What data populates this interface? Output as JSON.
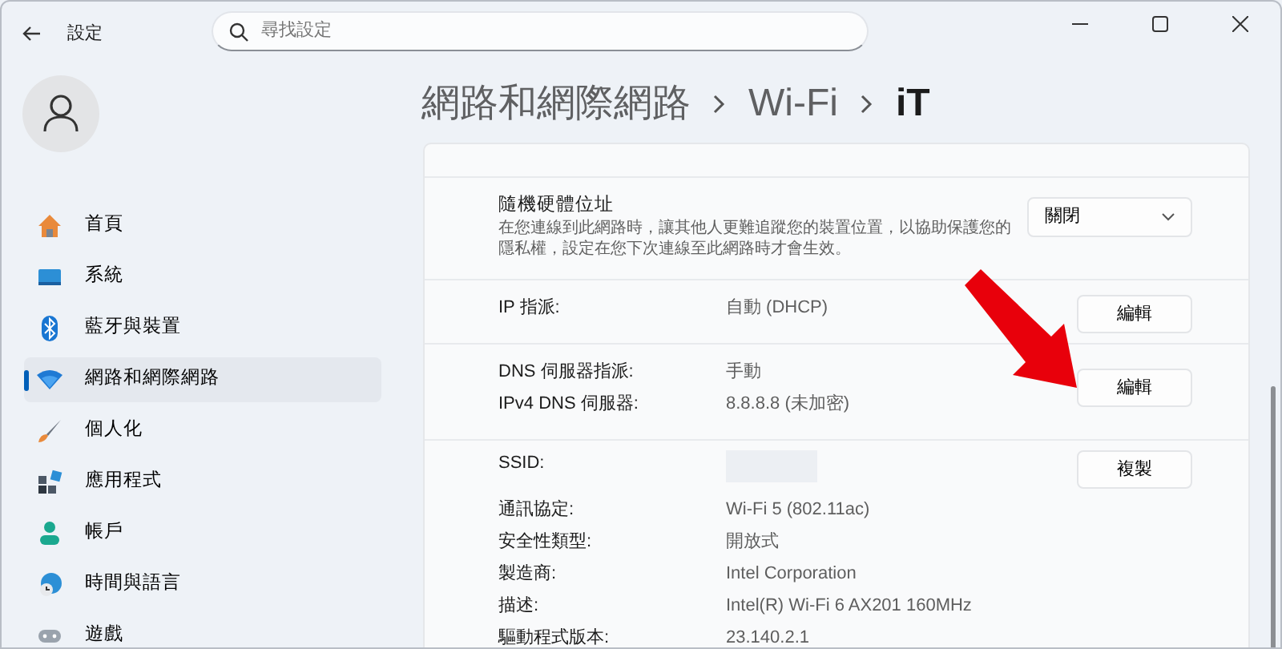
{
  "window": {
    "title": "設定"
  },
  "search": {
    "placeholder": "尋找設定"
  },
  "sidebar": {
    "items": [
      {
        "label": "首頁",
        "selected": false
      },
      {
        "label": "系統",
        "selected": false
      },
      {
        "label": "藍牙與裝置",
        "selected": false
      },
      {
        "label": "網路和網際網路",
        "selected": true
      },
      {
        "label": "個人化",
        "selected": false
      },
      {
        "label": "應用程式",
        "selected": false
      },
      {
        "label": "帳戶",
        "selected": false
      },
      {
        "label": "時間與語言",
        "selected": false
      },
      {
        "label": "遊戲",
        "selected": false
      }
    ]
  },
  "breadcrumb": [
    "網路和網際網路",
    "Wi-Fi",
    "iT"
  ],
  "sections": [
    {
      "kind": "setting",
      "title": "隨機硬體位址",
      "description": "在您連線到此網路時，讓其他人更難追蹤您的裝置位置，以協助保護您的隱私權，設定在您下次連線至此網路時才會生效。",
      "dropdown": "關閉"
    },
    {
      "kind": "rows",
      "button": "編輯",
      "rows": [
        {
          "label": "IP 指派:",
          "value": "自動 (DHCP)"
        }
      ]
    },
    {
      "kind": "rows",
      "button": "編輯",
      "rows": [
        {
          "label": "DNS 伺服器指派:",
          "value": "手動"
        },
        {
          "label": "IPv4 DNS 伺服器:",
          "value": "8.8.8.8 (未加密)"
        }
      ]
    },
    {
      "kind": "rows",
      "button": "複製",
      "rows": [
        {
          "label": "SSID:",
          "redacted": true
        },
        {
          "label": "通訊協定:",
          "value": "Wi-Fi 5 (802.11ac)"
        },
        {
          "label": "安全性類型:",
          "value": "開放式"
        },
        {
          "label": "製造商:",
          "value": "Intel Corporation"
        },
        {
          "label": "描述:",
          "value": "Intel(R) Wi-Fi 6 AX201 160MHz"
        },
        {
          "label": "驅動程式版本:",
          "value": "23.140.2.1"
        }
      ]
    }
  ]
}
